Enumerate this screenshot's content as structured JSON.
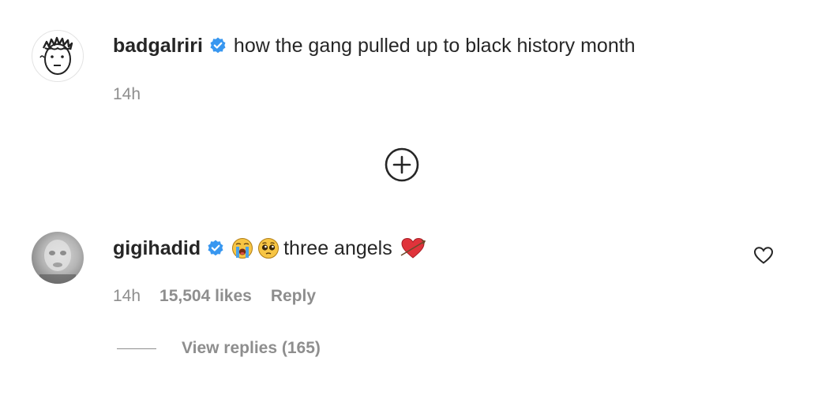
{
  "comments": [
    {
      "username": "badgalriri",
      "text": "how the gang pulled up to black history month",
      "time": "14h",
      "avatar_icon": "drawn-face-avatar"
    },
    {
      "username": "gigihadid",
      "emojis": [
        "loudly-crying-face-icon",
        "pleading-face-icon"
      ],
      "text": "three angels",
      "trailing_emoji": "heart-with-arrow-icon",
      "time": "14h",
      "likes": "15,504 likes",
      "reply_label": "Reply",
      "view_replies": "View replies (165)",
      "avatar_icon": "blurred-photo-avatar"
    }
  ],
  "load_more_icon": "plus-circle-icon",
  "like_icon": "heart-outline-icon",
  "colors": {
    "verified": "#3897f0",
    "text": "#262626",
    "muted": "#8e8e8e"
  }
}
